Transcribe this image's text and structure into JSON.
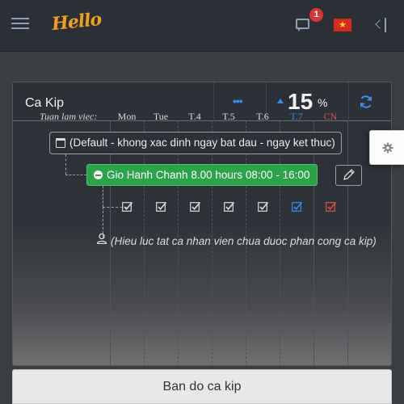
{
  "header": {
    "logo": "Hello",
    "notifications_count": "1",
    "language_flag": "vietnam-flag",
    "icons": [
      "menu-icon",
      "chat-icon",
      "collapse-sidebar-icon"
    ]
  },
  "card": {
    "title": "Ca Kip",
    "more_label": "•••",
    "percent_value": "15",
    "percent_sign": "%",
    "week_label": "Tuan lam viec:",
    "days": [
      "Mon",
      "Tue",
      "T.4",
      "T.5",
      "T.6",
      "T.7",
      "CN"
    ],
    "period_label": "(Default - khong xac dinh ngay bat dau - ngay ket thuc)",
    "shift_label": "Gio Hanh Chanh 8.00 hours 08:00 - 16:00",
    "note": "(Hieu luc tat ca nhan vien chua duoc phan cong ca kip)",
    "checkboxes": [
      {
        "day": "Mon",
        "checked": true,
        "color": "#dcdcdc"
      },
      {
        "day": "Tue",
        "checked": true,
        "color": "#dcdcdc"
      },
      {
        "day": "T.4",
        "checked": true,
        "color": "#dcdcdc"
      },
      {
        "day": "T.5",
        "checked": true,
        "color": "#dcdcdc"
      },
      {
        "day": "T.6",
        "checked": true,
        "color": "#dcdcdc"
      },
      {
        "day": "T.7",
        "checked": true,
        "color": "#3a8ee6"
      },
      {
        "day": "CN",
        "checked": true,
        "color": "#d9534f"
      }
    ]
  },
  "bottom_button": "Ban do ca kip",
  "colors": {
    "accent": "#3a8ee6",
    "shift_green": "#2ca24a",
    "sunday_red": "#d9534f",
    "logo_orange": "#f0a020",
    "badge_red": "#d93636"
  }
}
